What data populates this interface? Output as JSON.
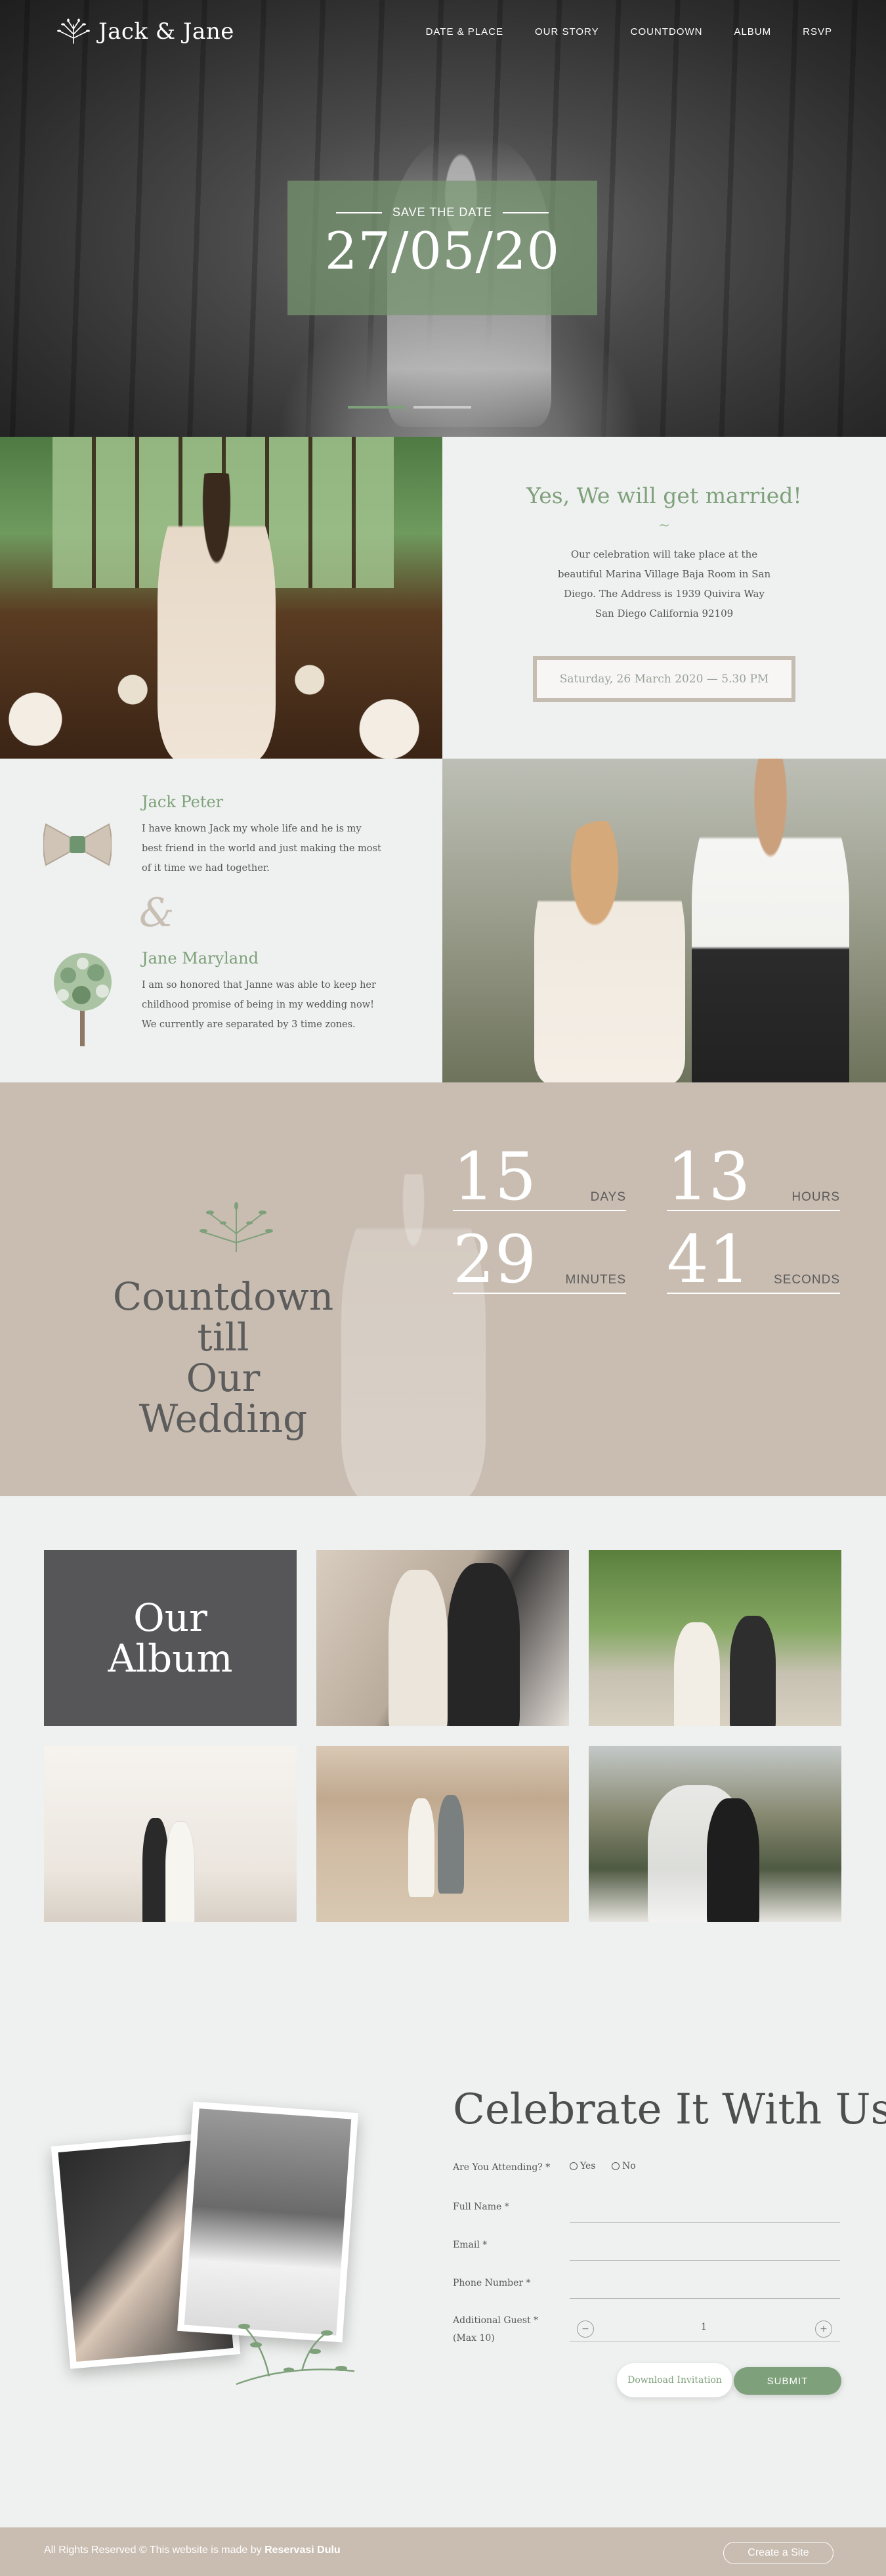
{
  "header": {
    "logo_text": "Jack & Jane",
    "nav": [
      "DATE & PLACE",
      "OUR STORY",
      "COUNTDOWN",
      "ALBUM",
      "RSVP"
    ]
  },
  "hero": {
    "save_label": "SAVE THE DATE",
    "date": "27/05/20",
    "slides": 2,
    "active_slide": 1
  },
  "married": {
    "title": "Yes, We will get married!",
    "divider": "~",
    "text": "Our celebration will take place at the beautiful Marina Village Baja Room in San Diego. The Address is 1939 Quivira Way San Diego California 92109",
    "date_button": "Saturday, 26 March 2020 — 5.30 PM"
  },
  "people": {
    "groom_name": "Jack Peter",
    "groom_text": "I have known Jack my whole life and he is my best friend in the world and just making the most of it time we had together.",
    "ampersand": "&",
    "bride_name": "Jane Maryland",
    "bride_text": "I am so honored that Janne was able to keep her childhood promise of being in my wedding now! We currently are separated by 3 time zones."
  },
  "countdown": {
    "title_line1": "Countdown till",
    "title_line2": "Our Wedding",
    "days": "15",
    "days_label": "DAYS",
    "hours": "13",
    "hours_label": "HOURS",
    "minutes": "29",
    "minutes_label": "MINUTES",
    "seconds": "41",
    "seconds_label": "SECONDS"
  },
  "album": {
    "title_line1": "Our",
    "title_line2": "Album"
  },
  "rsvp": {
    "title": "Celebrate It With Us!",
    "attending_label": "Are You Attending? *",
    "yes_label": "Yes",
    "no_label": "No",
    "fullname_label": "Full Name *",
    "email_label": "Email *",
    "phone_label": "Phone Number *",
    "guest_label": "Additional Guest *",
    "guest_sub": "(Max 10)",
    "guest_value": "1",
    "minus": "−",
    "plus": "+",
    "download_button": "Download Invitation",
    "submit_button": "SUBMIT"
  },
  "footer": {
    "text": "All Rights Reserved © This website is made by",
    "brand": "Reservasi Dulu",
    "create_button": "Create a Site"
  },
  "colors": {
    "accent_green": "#7ea07a",
    "taupe": "#c9bdb1",
    "dark_gray": "#565658",
    "background": "#eff1f0"
  }
}
